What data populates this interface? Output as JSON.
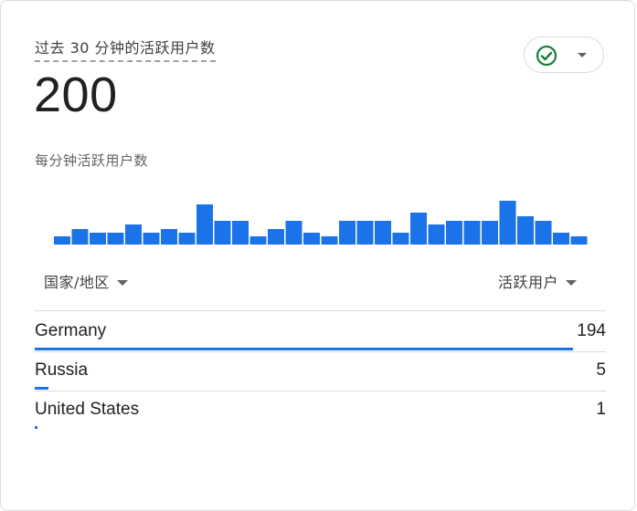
{
  "card": {
    "title": "过去 30 分钟的活跃用户数",
    "total": "200",
    "subtitle": "每分钟活跃用户数",
    "status_icon": "check-circle-icon",
    "accent_color": "#1a73e8",
    "status_color": "#188038"
  },
  "sparkline": {
    "values": [
      2,
      4,
      3,
      3,
      5,
      3,
      4,
      3,
      10,
      6,
      6,
      2,
      4,
      6,
      3,
      2,
      6,
      6,
      6,
      3,
      8,
      5,
      6,
      6,
      6,
      11,
      7,
      6,
      3,
      2
    ]
  },
  "table": {
    "col_country": "国家/地区",
    "col_users": "活跃用户",
    "rows": [
      {
        "country": "Germany",
        "users": "194",
        "share": 0.97
      },
      {
        "country": "Russia",
        "users": "5",
        "share": 0.025
      },
      {
        "country": "United States",
        "users": "1",
        "share": 0.005
      }
    ]
  }
}
